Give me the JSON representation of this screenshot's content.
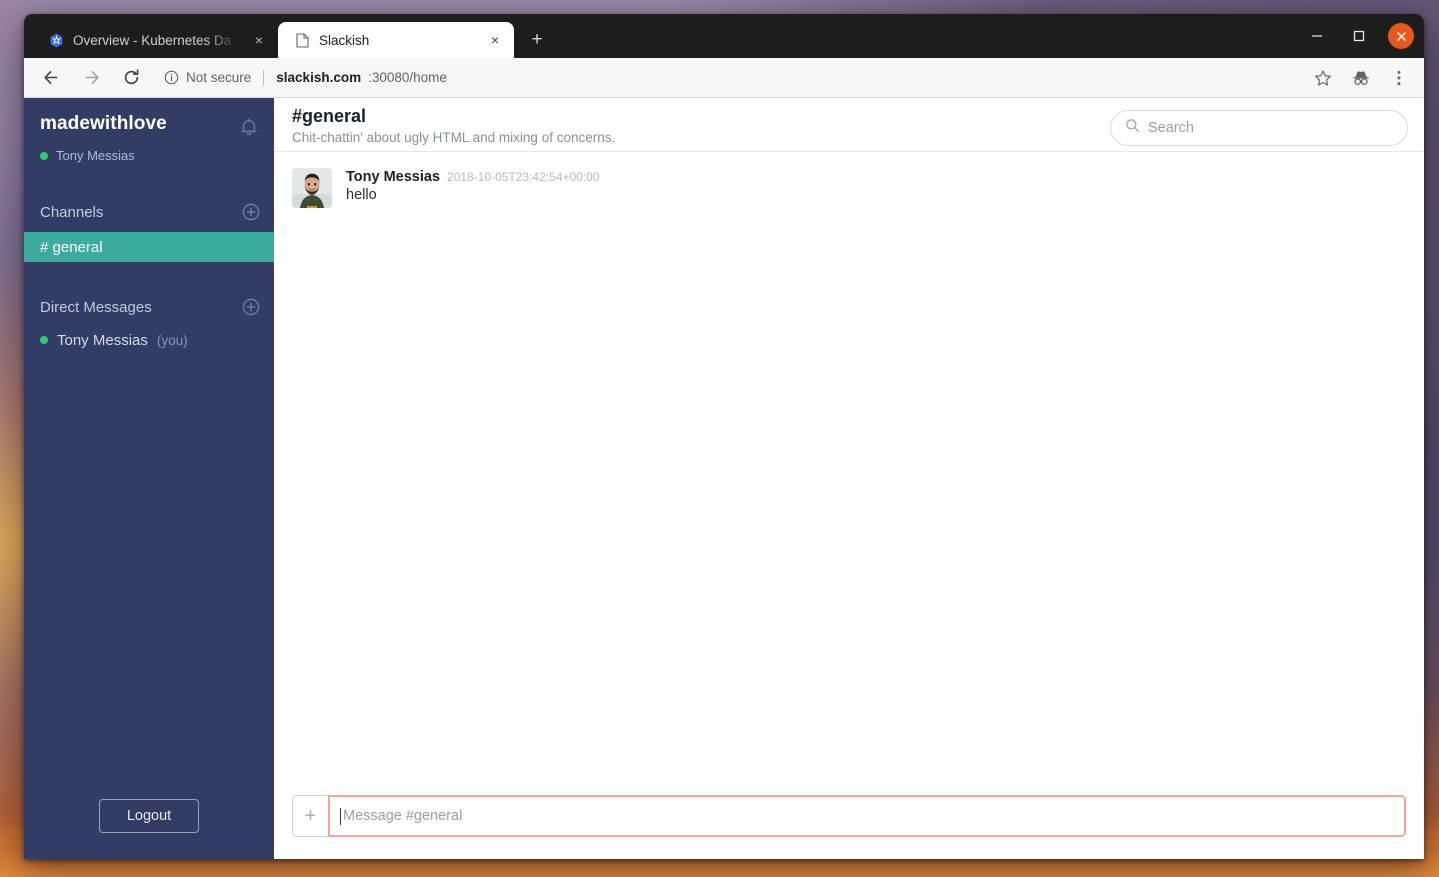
{
  "browser": {
    "tabs": [
      {
        "title": "Overview - Kubernetes Da",
        "favicon": "kubernetes-icon",
        "active": false,
        "close_label": "×"
      },
      {
        "title": "Slackish",
        "favicon": "page-icon",
        "active": true,
        "close_label": "×"
      }
    ],
    "new_tab_label": "+",
    "window_controls": {
      "minimize_label": "—",
      "maximize_label": "□",
      "close_label": "✕"
    },
    "toolbar": {
      "back_label": "←",
      "forward_label": "→",
      "reload_label": "↻",
      "security_text": "Not secure",
      "url_host": "slackish.com",
      "url_rest": ":30080/home",
      "bookmark_icon": "star-icon",
      "incognito_icon": "incognito-icon",
      "menu_icon": "three-dot-menu-icon"
    }
  },
  "sidebar": {
    "workspace_name": "madewithlove",
    "notifications_icon": "bell-icon",
    "current_user": "Tony Messias",
    "channels_section": {
      "label": "Channels",
      "add_label": "+",
      "items": [
        {
          "name": "# general",
          "active": true
        }
      ]
    },
    "dms_section": {
      "label": "Direct Messages",
      "add_label": "+",
      "items": [
        {
          "name": "Tony Messias",
          "suffix": "(you)",
          "online": true
        }
      ]
    },
    "logout_label": "Logout"
  },
  "main": {
    "channel_title": "#general",
    "channel_topic": "Chit-chattin' about ugly HTML and mixing of concerns.",
    "search": {
      "placeholder": "Search",
      "value": "",
      "icon": "search-icon"
    },
    "messages": [
      {
        "author": "Tony Messias",
        "timestamp": "2018-10-05T23:42:54+00:00",
        "text": "hello",
        "avatar": "user-photo-avatar"
      }
    ],
    "composer": {
      "attach_label": "+",
      "placeholder": "Message #general",
      "value": ""
    }
  },
  "colors": {
    "sidebar_bg": "#333c64",
    "active_channel": "#3bab9d",
    "online_dot": "#2ecc71",
    "composer_focus": "#eeab94",
    "close_button": "#e8581c"
  }
}
